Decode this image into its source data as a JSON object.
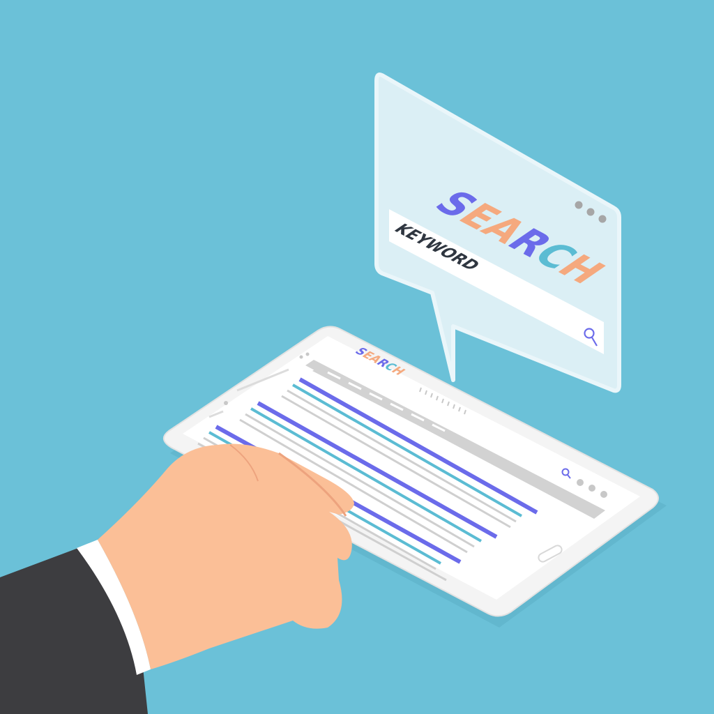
{
  "popup": {
    "title_letters": [
      {
        "char": "S",
        "color": "#6b6bea"
      },
      {
        "char": "E",
        "color": "#f5a97e"
      },
      {
        "char": "A",
        "color": "#f5a97e"
      },
      {
        "char": "R",
        "color": "#6b6bea"
      },
      {
        "char": "C",
        "color": "#5bbcd3"
      },
      {
        "char": "H",
        "color": "#f5a97e"
      }
    ],
    "search_field_value": "KEYWORD",
    "search_icon": "magnifier-icon",
    "window_dots": 3
  },
  "tablet": {
    "header_letters": [
      {
        "char": "S",
        "color": "#6b6bea"
      },
      {
        "char": "E",
        "color": "#f5a97e"
      },
      {
        "char": "A",
        "color": "#f5a97e"
      },
      {
        "char": "R",
        "color": "#6b6bea"
      },
      {
        "char": "C",
        "color": "#5bbcd3"
      },
      {
        "char": "H",
        "color": "#f5a97e"
      }
    ],
    "search_icon": "magnifier-icon",
    "window_dots": 3,
    "result_colors": {
      "title": "#6b6bea",
      "url": "#5bbcd3",
      "text": "#cfcfcf"
    }
  },
  "colors": {
    "background": "#6bc1d8",
    "skin": "#fbbf97",
    "suit": "#3d3d40",
    "cuff": "#ffffff"
  }
}
